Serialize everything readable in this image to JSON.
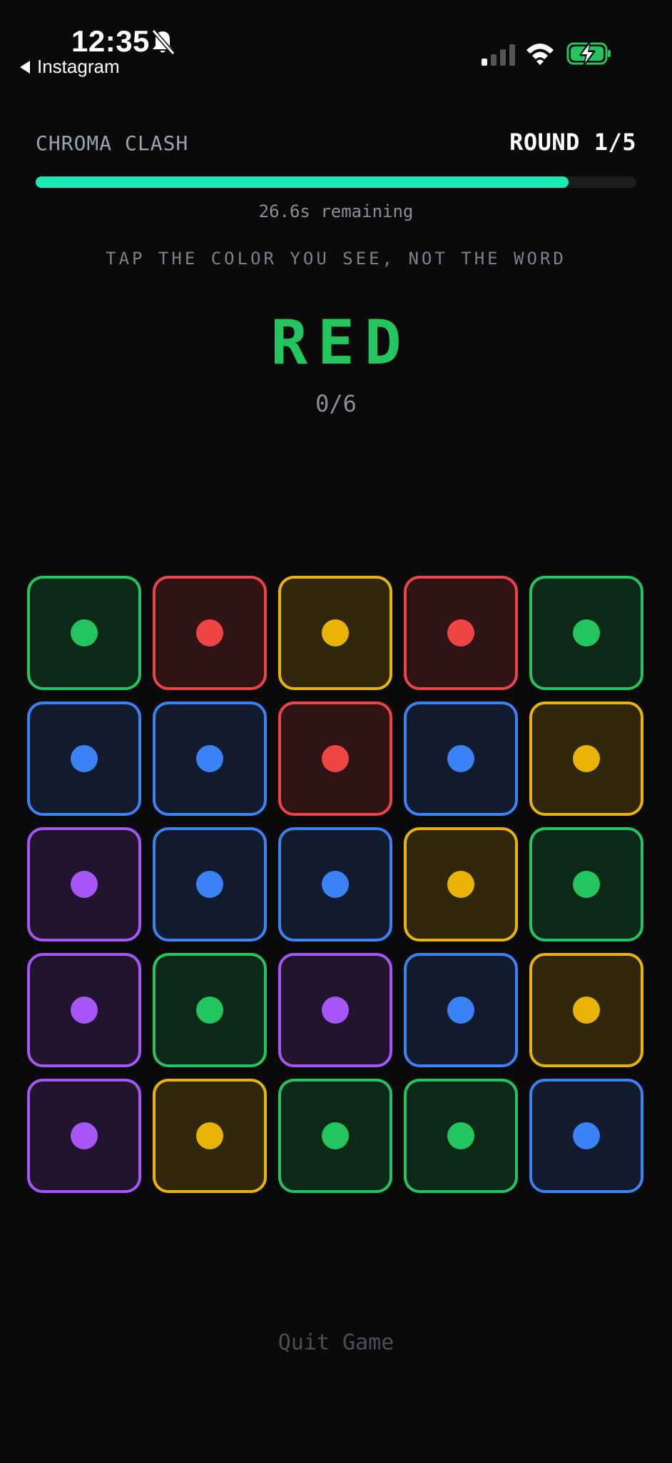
{
  "status_bar": {
    "time": "12:35",
    "back_label": "Instagram",
    "icons": [
      "bell-slash-icon",
      "cellular-signal-icon",
      "wifi-icon",
      "battery-charging-icon"
    ]
  },
  "header": {
    "game_title": "CHROMA CLASH",
    "round_label": "ROUND 1/5"
  },
  "timer": {
    "progress": 0.887,
    "remaining_text": "26.6s remaining",
    "bar_color": "#1de9b6"
  },
  "prompt": {
    "instruction": "TAP THE COLOR YOU SEE, NOT THE WORD",
    "word": "RED",
    "word_color": "#22c55e",
    "score": "0/6"
  },
  "palette": {
    "green": {
      "border": "#22c55e",
      "fill": "#0c2818",
      "dot": "#22c55e"
    },
    "red": {
      "border": "#ef4444",
      "fill": "#2f1315",
      "dot": "#ef4444"
    },
    "yellow": {
      "border": "#eab308",
      "fill": "#30270c",
      "dot": "#eab308"
    },
    "blue": {
      "border": "#3b82f6",
      "fill": "#121b2d",
      "dot": "#3b82f6"
    },
    "purple": {
      "border": "#a855f7",
      "fill": "#21152e",
      "dot": "#a855f7"
    }
  },
  "grid": [
    [
      "green",
      "red",
      "yellow",
      "red",
      "green"
    ],
    [
      "blue",
      "blue",
      "red",
      "blue",
      "yellow"
    ],
    [
      "purple",
      "blue",
      "blue",
      "yellow",
      "green"
    ],
    [
      "purple",
      "green",
      "purple",
      "blue",
      "yellow"
    ],
    [
      "purple",
      "yellow",
      "green",
      "green",
      "blue"
    ]
  ],
  "footer": {
    "quit_label": "Quit Game"
  }
}
